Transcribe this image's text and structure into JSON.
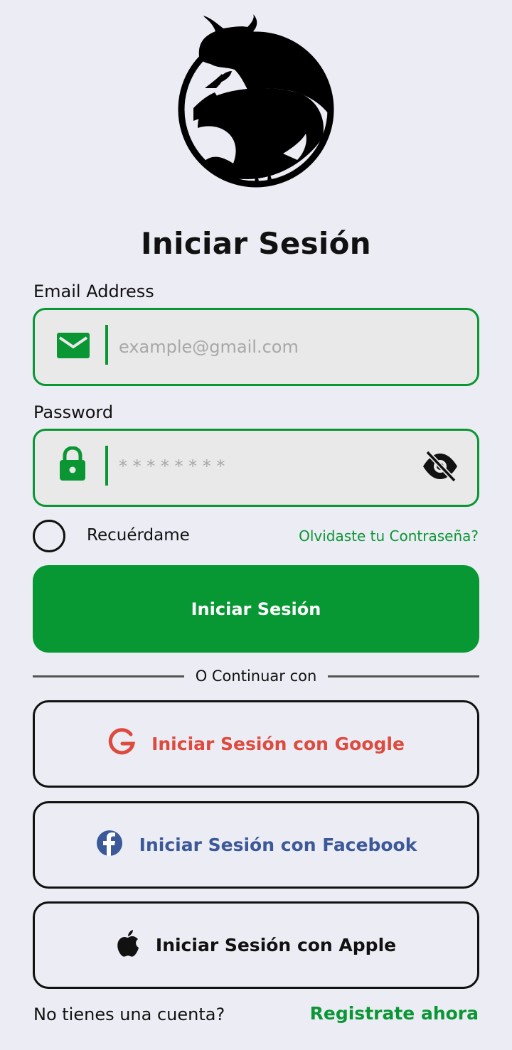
{
  "header": {
    "title": "Iniciar Sesión"
  },
  "email": {
    "label": "Email Address",
    "placeholder": "example@gmail.com",
    "icon": "envelope-icon"
  },
  "password": {
    "label": "Password",
    "placeholder": "* * * * * * * *",
    "icon": "lock-icon",
    "toggle_icon": "eye-off-icon"
  },
  "remember": {
    "label": "Recuérdame",
    "checked": false
  },
  "forgot": {
    "label": "Olvidaste tu Contraseña?"
  },
  "login_button": {
    "label": "Iniciar Sesión"
  },
  "separator": {
    "label": "O Continuar con"
  },
  "social": {
    "google": {
      "label": "Iniciar Sesión con Google",
      "icon": "google-icon",
      "color": "#dd4b3e"
    },
    "facebook": {
      "label": "Iniciar Sesión con Facebook",
      "icon": "facebook-icon",
      "color": "#3b5998"
    },
    "apple": {
      "label": "Iniciar Sesión con Apple",
      "icon": "apple-icon",
      "color": "#111111"
    }
  },
  "footer": {
    "prompt": "No tienes una cuenta?",
    "register_link": "Registrate ahora"
  },
  "colors": {
    "accent": "#0a9633",
    "background": "#ececf4",
    "field_bg": "#e9e9ea"
  }
}
